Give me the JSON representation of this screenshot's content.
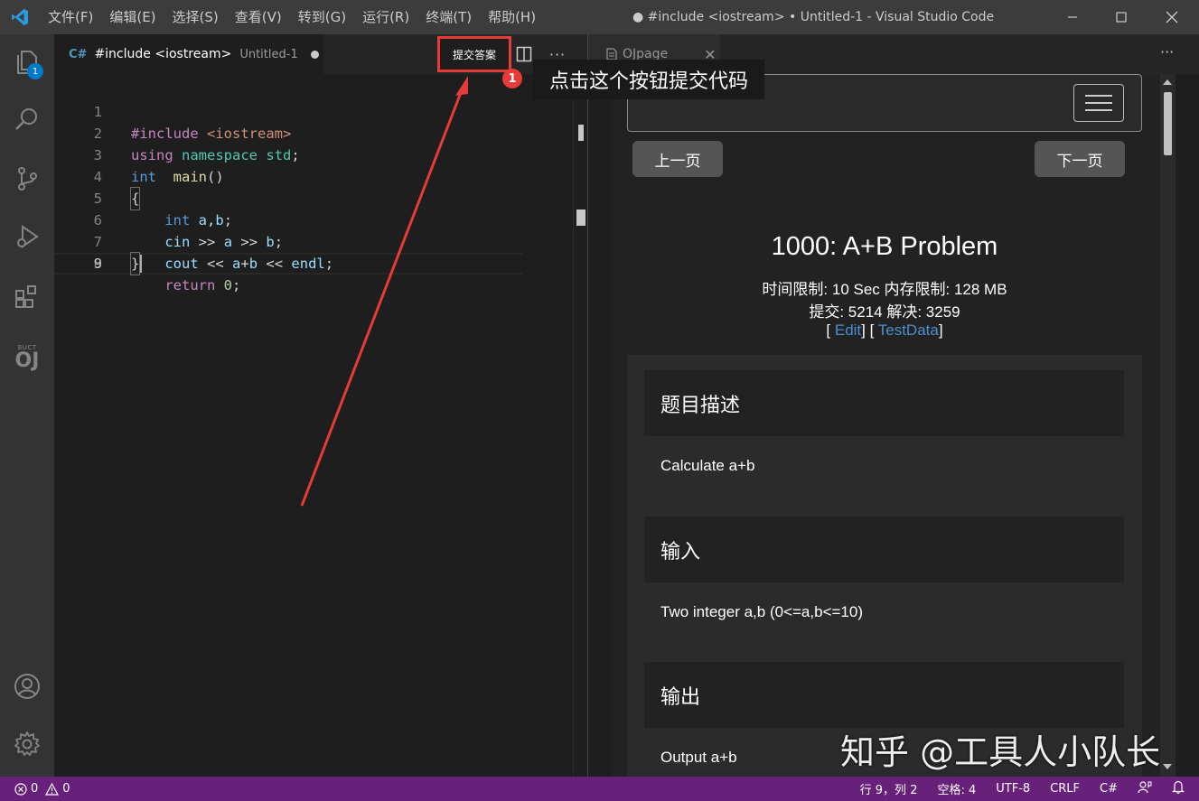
{
  "titlebar": {
    "menu": [
      "文件(F)",
      "编辑(E)",
      "选择(S)",
      "查看(V)",
      "转到(G)",
      "运行(R)",
      "终端(T)",
      "帮助(H)"
    ],
    "title": "● #include <iostream> • Untitled-1 - Visual Studio Code"
  },
  "activitybar": {
    "explorer_badge": "1",
    "oj_small": "BUCT",
    "oj_big": "OJ"
  },
  "editor": {
    "tab": {
      "name": "#include <iostream>",
      "desc": "Untitled-1",
      "icon": "C#"
    },
    "submit_label": "提交答案",
    "more_label": "···",
    "line_numbers": [
      "1",
      "2",
      "3",
      "4",
      "5",
      "6",
      "7",
      "8",
      "9"
    ]
  },
  "callout": {
    "number": "1",
    "text": "点击这个按钮提交代码"
  },
  "preview": {
    "tab": {
      "name": "OJpage",
      "close": "✕"
    },
    "more_label": "···",
    "prev_label": "上一页",
    "next_label": "下一页",
    "problem_title": "1000: A+B Problem",
    "limits": "时间限制: 10 Sec  内存限制: 128 MB",
    "stats": "提交: 5214  解决: 3259",
    "edit_link": "Edit",
    "testdata_link": "TestData",
    "sections": [
      {
        "heading": "题目描述",
        "body": "Calculate a+b"
      },
      {
        "heading": "输入",
        "body": "Two integer a,b (0<=a,b<=10)"
      },
      {
        "heading": "输出",
        "body": "Output a+b"
      }
    ]
  },
  "statusbar": {
    "errors": "0",
    "warnings": "0",
    "position": "行 9，列 2",
    "spaces": "空格: 4",
    "encoding": "UTF-8",
    "eol": "CRLF",
    "language": "C#"
  },
  "watermark": "知乎 @工具人小队长",
  "colors": {
    "statusbar": "#68217a",
    "accent_red": "#e63b36",
    "link": "#4a8ed4",
    "vscode_blue": "#007acc"
  }
}
